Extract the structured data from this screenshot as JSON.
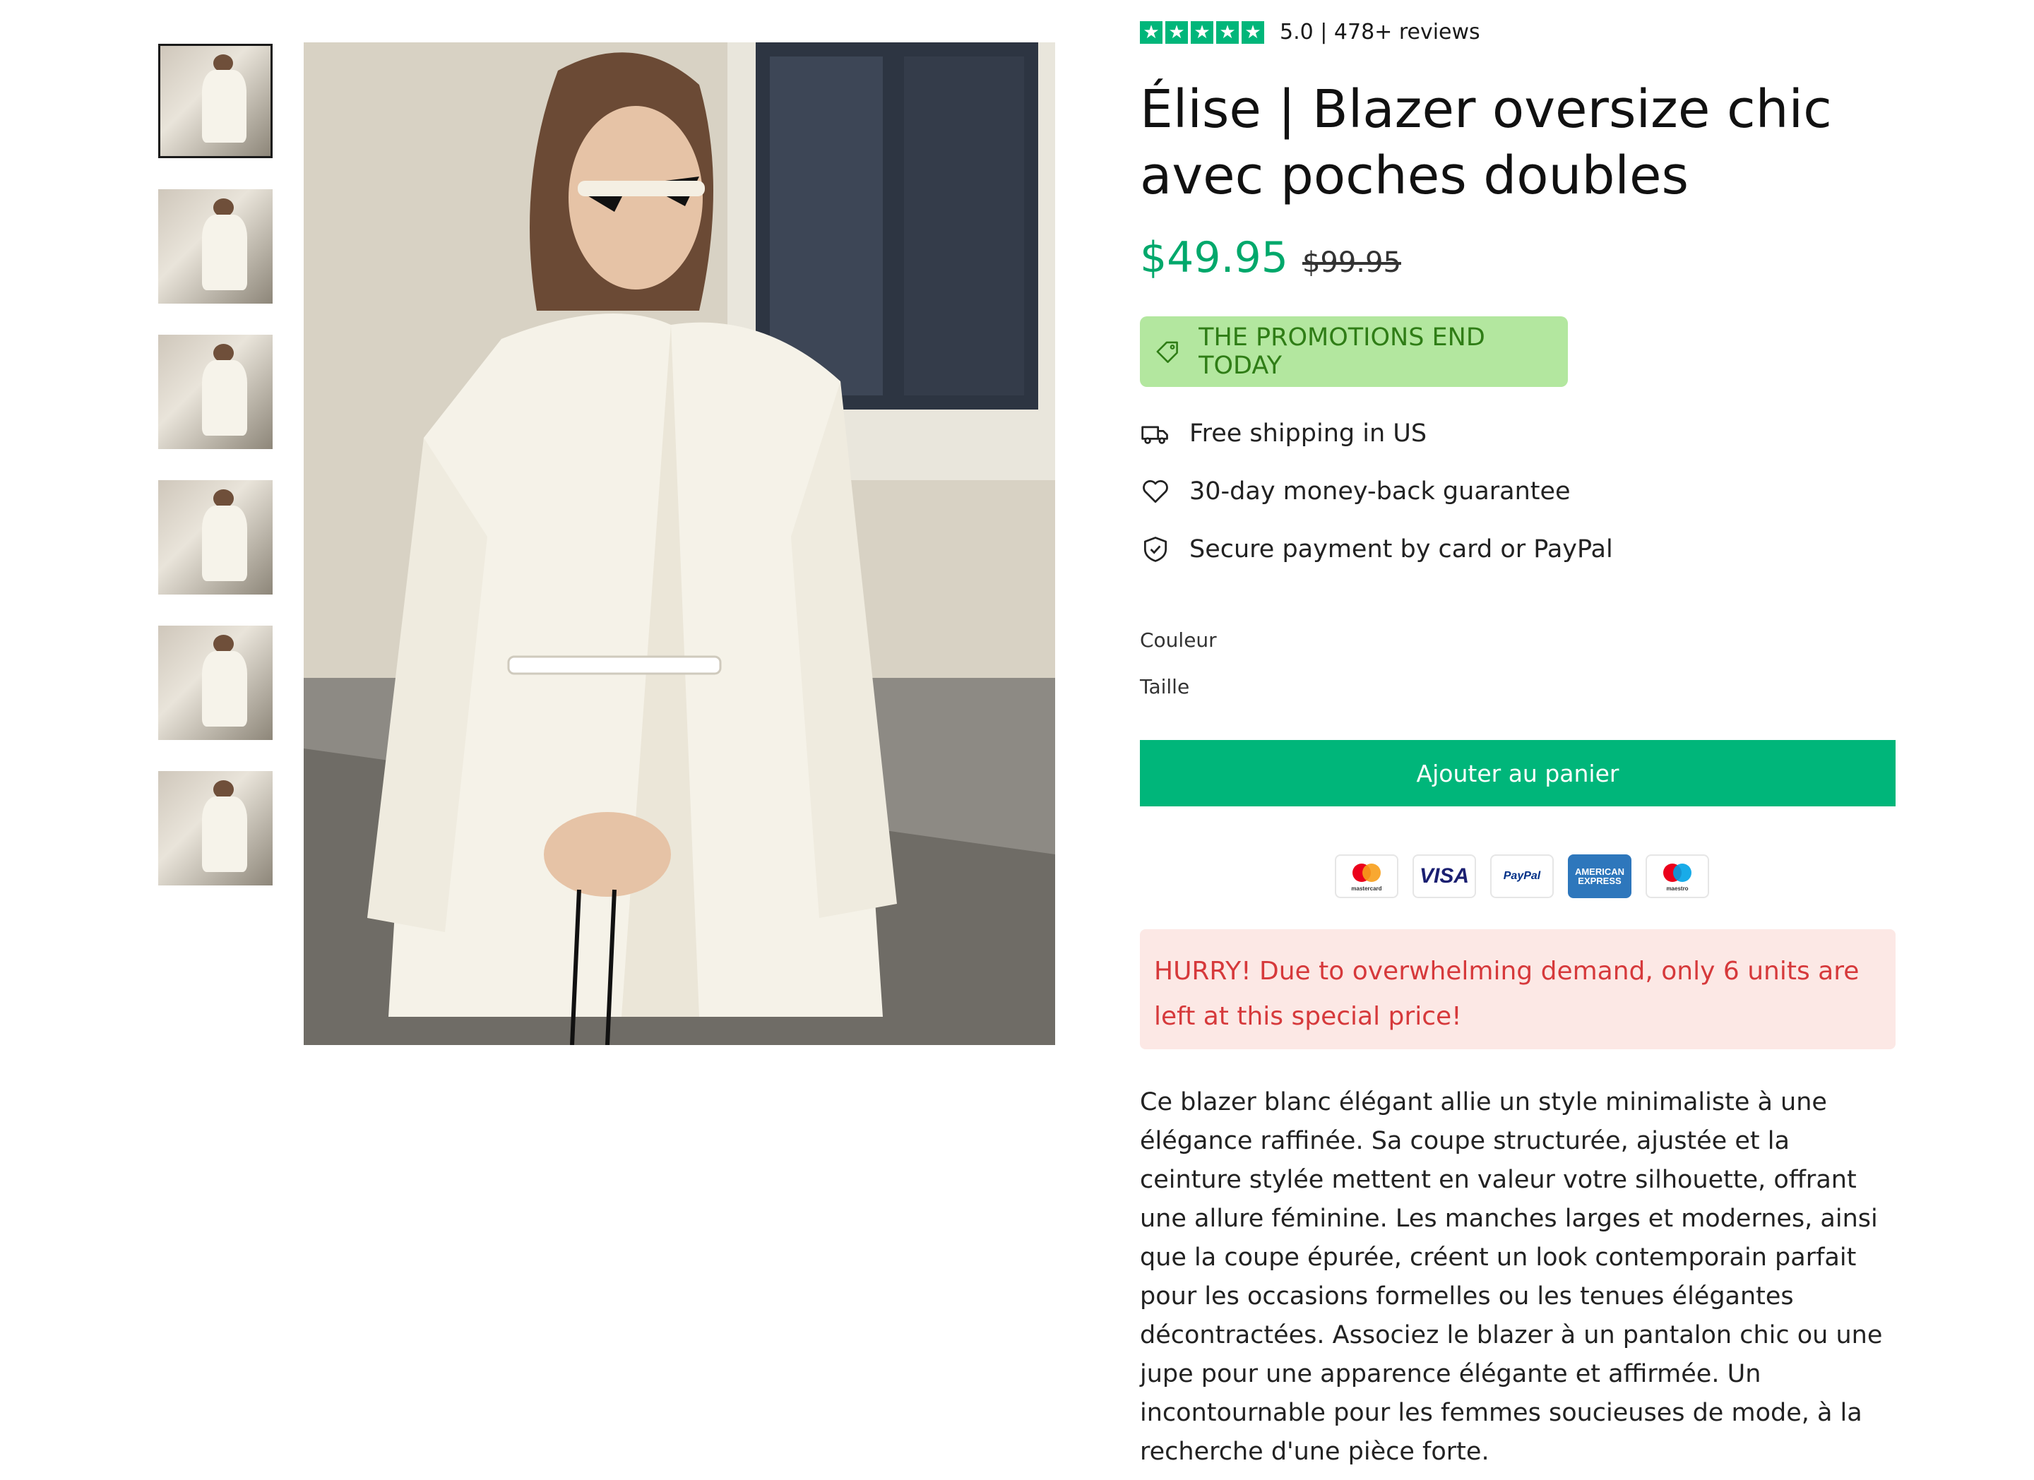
{
  "gallery": {
    "thumbnails": [
      {
        "alt": "thumbnail-1",
        "selected": true
      },
      {
        "alt": "thumbnail-2",
        "selected": false
      },
      {
        "alt": "thumbnail-3",
        "selected": false
      },
      {
        "alt": "thumbnail-4",
        "selected": false
      },
      {
        "alt": "thumbnail-5",
        "selected": false
      },
      {
        "alt": "thumbnail-6",
        "selected": false
      }
    ]
  },
  "rating": {
    "stars": 5,
    "text": "5.0 | 478+ reviews",
    "star_color": "#00b67a"
  },
  "product": {
    "title": "Élise | Blazer oversize chic avec poches doubles",
    "price": "$49.95",
    "compare_price": "$99.95",
    "price_color": "#00a86b"
  },
  "promo": {
    "text": "THE PROMOTIONS END TODAY",
    "icon": "tag-icon",
    "bg_color": "#b3e79f",
    "text_color": "#2f7d16"
  },
  "features": [
    {
      "icon": "truck-icon",
      "text": "Free shipping in US"
    },
    {
      "icon": "heart-icon",
      "text": "30-day money-back guarantee"
    },
    {
      "icon": "shield-check-icon",
      "text": "Secure payment by card or PayPal"
    }
  ],
  "options": {
    "color_label": "Couleur",
    "size_label": "Taille"
  },
  "cart": {
    "button_label": "Ajouter au panier",
    "button_color": "#00b67a"
  },
  "payments": {
    "mastercard_label": "mastercard",
    "visa_label": "VISA",
    "paypal_label": "PayPal",
    "amex_label": "AMERICAN EXPRESS",
    "maestro_label": "maestro"
  },
  "urgency": {
    "text": "HURRY! Due to overwhelming demand, only 6 units are left at this special price!",
    "bg_color": "#fce8e5",
    "text_color": "#d6393b"
  },
  "description": "Ce blazer blanc élégant allie un style minimaliste à une élégance raffinée. Sa coupe structurée, ajustée et la ceinture stylée mettent en valeur votre silhouette, offrant une allure féminine. Les manches larges et modernes, ainsi que la coupe épurée, créent un look contemporain parfait pour les occasions formelles ou les tenues élégantes décontractées. Associez le blazer à un pantalon chic ou une jupe pour une apparence élégante et affirmée. Un incontournable pour les femmes soucieuses de mode, à la recherche d'une pièce forte."
}
